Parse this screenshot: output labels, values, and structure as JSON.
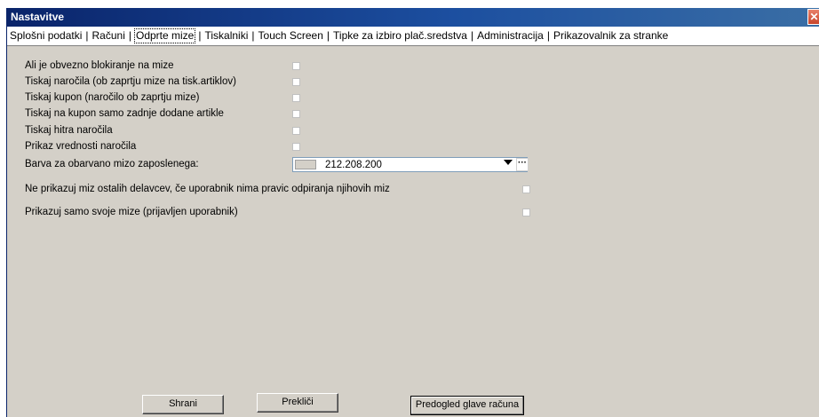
{
  "window": {
    "title": "Nastavitve",
    "close_glyph": "✕"
  },
  "tabs": [
    {
      "label": "Splošni podatki"
    },
    {
      "label": "Računi"
    },
    {
      "label": "Odprte mize",
      "active": true
    },
    {
      "label": "Tiskalniki"
    },
    {
      "label": "Touch Screen"
    },
    {
      "label": "Tipke za izbiro plač.sredstva"
    },
    {
      "label": "Administracija"
    },
    {
      "label": "Prikazovalnik za stranke"
    }
  ],
  "settings": {
    "block_tables_label": "Ali je obvezno blokiranje na mize",
    "print_orders_label": "Tiskaj naročila (ob zaprtju mize na tisk.artiklov)",
    "print_coupon_label": "Tiskaj kupon (naročilo ob zaprtju mize)",
    "print_last_added_label": "Tiskaj na kupon samo zadnje dodane artikle",
    "print_quick_orders_label": "Tiskaj hitra naročila",
    "show_order_value_label": "Prikaz vrednosti naročila",
    "employee_color_label": "Barva za obarvano mizo zaposlenega:",
    "employee_color_value": "212.208.200",
    "hide_other_tables_label": "Ne prikazuj miz ostalih delavcev, če uporabnik nima pravic odpiranja njihovih miz",
    "show_own_tables_label": "Prikazuj samo svoje mize (prijavljen uporabnik)"
  },
  "colors": {
    "employee_color_swatch": "#d4d0c8",
    "window_background": "#d4d0c8",
    "titlebar": "#0a246a"
  },
  "buttons": {
    "save": "Shrani",
    "cancel": "Prekliči",
    "preview_header": "Predogled glave računa"
  },
  "icons": {
    "dropdown": "chevron-down-icon",
    "browse": "ellipsis-icon",
    "close": "close-icon"
  }
}
